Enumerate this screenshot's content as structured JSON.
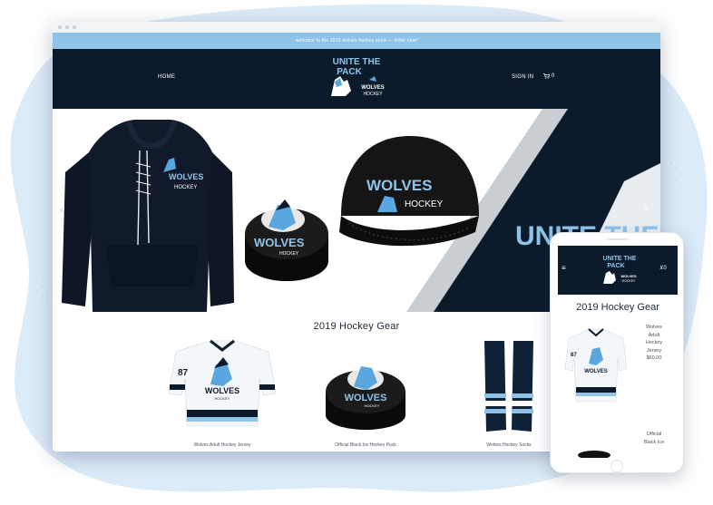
{
  "colors": {
    "navy": "#0c1b2c",
    "light_blue": "#8fc3e8",
    "accent_blue": "#5aa6de",
    "blob": "#dcebf8"
  },
  "announcement": "welcome to the 2019 wolves hockey store — order now!",
  "nav": {
    "home": "HOME",
    "sign_in": "SIGN IN",
    "cart_count": "0"
  },
  "logo": {
    "line1": "UNITE THE",
    "line2": "PACK",
    "team": "WOLVES",
    "sport": "HOCKEY"
  },
  "hero": {
    "hoodie_text": {
      "team": "WOLVES",
      "sport": "HOCKEY"
    },
    "puck_text": {
      "team": "WOLVES",
      "sport": "HOCKEY"
    },
    "cap_text": {
      "team": "WOLVES",
      "sport": "HOCKEY"
    },
    "banner_text": "UNITE THE"
  },
  "section_title": "2019 Hockey Gear",
  "products": [
    {
      "name": "Wolves Adult Hockey Jersey",
      "jersey_number": "87"
    },
    {
      "name": "Official Black Ice Hockey Puck"
    },
    {
      "name": "Wolves Hockey Socks"
    }
  ],
  "mobile": {
    "cart_count": "0",
    "title": "2019 Hockey Gear",
    "product_lines": [
      "Wolves",
      "Adult",
      "Hockey",
      "Jersey",
      "$60.00"
    ],
    "next_product_lines": [
      "Official",
      "Black Ice"
    ]
  },
  "icons": [
    "menu-icon",
    "cart-icon",
    "chevron-left-icon",
    "chevron-right-icon"
  ]
}
